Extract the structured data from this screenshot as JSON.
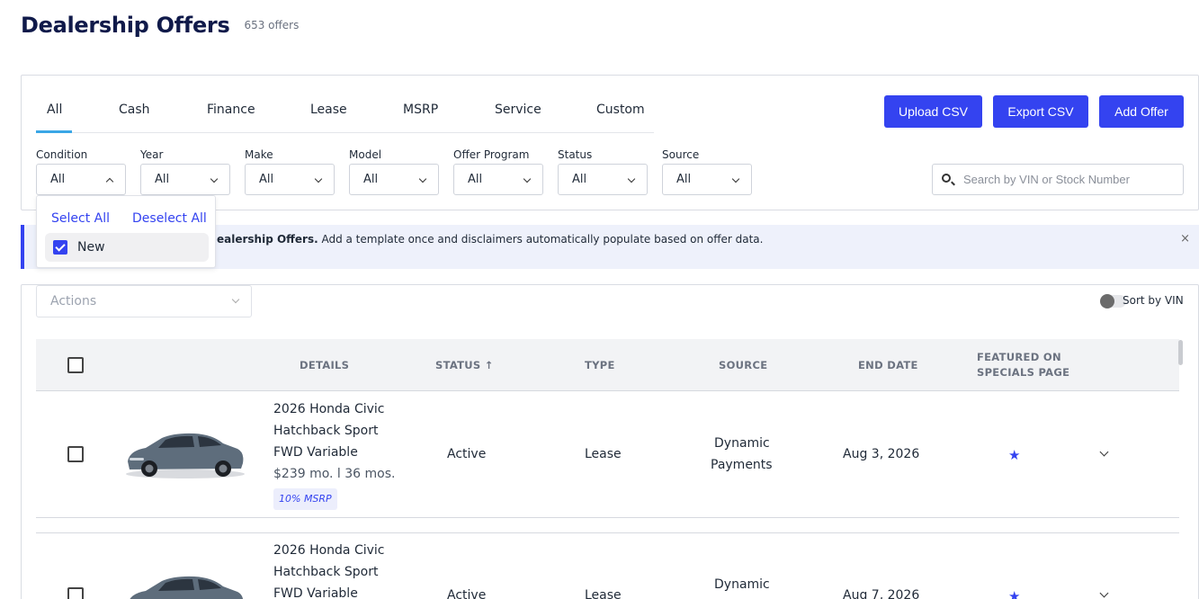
{
  "header": {
    "title": "Dealership Offers",
    "count": "653 offers"
  },
  "tabs": [
    {
      "label": "All",
      "active": true
    },
    {
      "label": "Cash"
    },
    {
      "label": "Finance"
    },
    {
      "label": "Lease"
    },
    {
      "label": "MSRP"
    },
    {
      "label": "Service"
    },
    {
      "label": "Custom"
    }
  ],
  "buttons": {
    "upload": "Upload CSV",
    "export": "Export CSV",
    "add": "Add Offer"
  },
  "filters": [
    {
      "label": "Condition",
      "value": "All"
    },
    {
      "label": "Year",
      "value": "All"
    },
    {
      "label": "Make",
      "value": "All"
    },
    {
      "label": "Model",
      "value": "All"
    },
    {
      "label": "Offer Program",
      "value": "All"
    },
    {
      "label": "Status",
      "value": "All"
    },
    {
      "label": "Source",
      "value": "All"
    }
  ],
  "search": {
    "placeholder": "Search by VIN or Stock Number"
  },
  "condition_dropdown": {
    "select_all": "Select All",
    "deselect_all": "Deselect All",
    "option": "New",
    "checked": true
  },
  "banner": {
    "bold": "ealership Offers.",
    "text": " Add a template once and disclaimers automatically populate based on offer data.",
    "close": "×"
  },
  "table": {
    "actions_placeholder": "Actions",
    "sort_by_vin": "Sort by VIN",
    "headers": {
      "details": "DETAILS",
      "status": "STATUS ↑",
      "type": "TYPE",
      "source": "SOURCE",
      "end_date": "END DATE",
      "featured_1": "FEATURED ON",
      "featured_2": "SPECIALS PAGE"
    },
    "rows": [
      {
        "line1": "2026 Honda Civic",
        "line2": "Hatchback Sport",
        "line3": "FWD Variable",
        "price": "$239 mo. l 36 mos.",
        "tag": "10% MSRP",
        "status": "Active",
        "type": "Lease",
        "source1": "Dynamic",
        "source2": "Payments",
        "end_date": "Aug 3, 2026",
        "featured": true
      },
      {
        "line1": "2026 Honda Civic",
        "line2": "Hatchback Sport",
        "line3": "FWD Variable",
        "status": "Active",
        "type": "Lease",
        "source1": "Dynamic",
        "end_date": "Aug 7, 2026",
        "featured": true
      }
    ]
  },
  "colors": {
    "primary": "#3443f0",
    "tab_underline": "#3aa6e6",
    "title": "#101a4a"
  },
  "icons": [
    "search-icon",
    "chevron-down-icon",
    "chevron-up-icon",
    "close-icon",
    "star-icon",
    "checkbox-icon",
    "car-image"
  ]
}
